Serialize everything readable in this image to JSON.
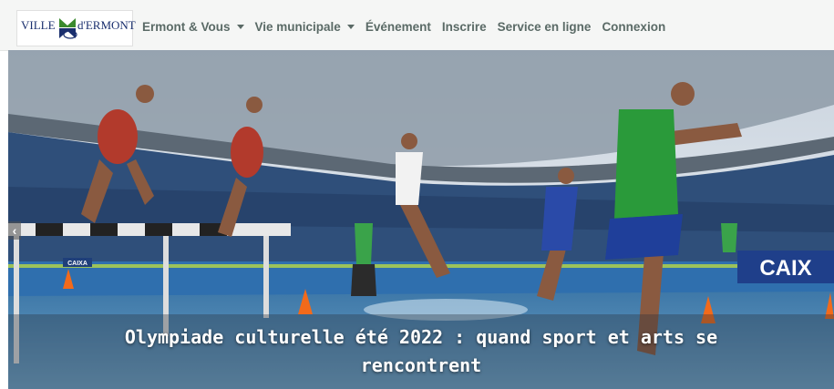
{
  "logo": {
    "left_text": "VILLE",
    "right_text": "d'ERMONT"
  },
  "nav": [
    {
      "label": "Ermont & Vous",
      "dropdown": true
    },
    {
      "label": "Vie municipale",
      "dropdown": true
    },
    {
      "label": "Événement",
      "dropdown": false
    },
    {
      "label": "Inscrire",
      "dropdown": false
    },
    {
      "label": "Service en ligne",
      "dropdown": false
    },
    {
      "label": "Connexion",
      "dropdown": false
    }
  ],
  "hero": {
    "caption": "Olympiade culturelle été 2022 : quand sport et arts se rencontrent",
    "prev_icon": "‹",
    "banner_left": "CAIXA",
    "banner_right": "CAIX"
  }
}
